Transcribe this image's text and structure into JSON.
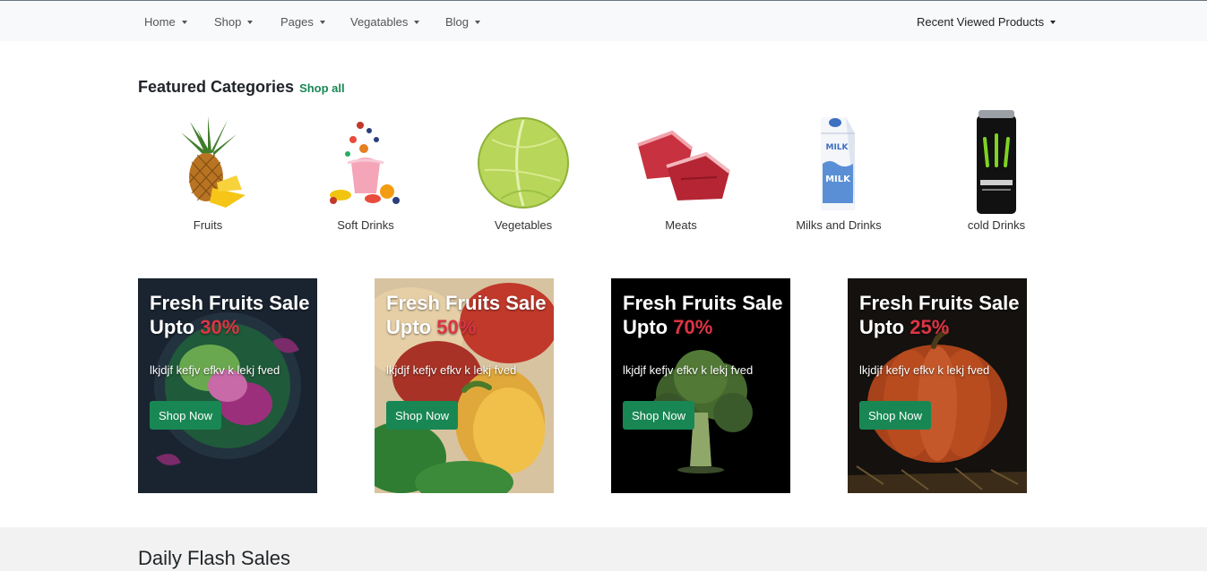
{
  "nav": {
    "items": [
      {
        "label": "Home"
      },
      {
        "label": "Shop"
      },
      {
        "label": "Pages"
      },
      {
        "label": "Vegatables"
      },
      {
        "label": "Blog"
      }
    ],
    "recent": "Recent Viewed Products"
  },
  "featured": {
    "title": "Featured Categories",
    "shop_all": "Shop all",
    "categories": [
      {
        "label": "Fruits",
        "icon": "pineapple-icon"
      },
      {
        "label": "Soft Drinks",
        "icon": "smoothie-splash-icon"
      },
      {
        "label": "Vegetables",
        "icon": "cabbage-icon"
      },
      {
        "label": "Meats",
        "icon": "meat-icon"
      },
      {
        "label": "Milks and Drinks",
        "icon": "milk-carton-icon"
      },
      {
        "label": "cold Drinks",
        "icon": "energy-drink-can-icon"
      }
    ]
  },
  "promos": [
    {
      "line1": "Fresh Fruits Sale",
      "upto": "Upto",
      "percent": "30%",
      "desc": "lkjdjf kefjv efkv k lekj fved",
      "button": "Shop Now"
    },
    {
      "line1": "Fresh Fruits Sale",
      "upto": "Upto",
      "percent": "50%",
      "desc": "lkjdjf kefjv efkv k lekj fved",
      "button": "Shop Now"
    },
    {
      "line1": "Fresh Fruits Sale",
      "upto": "Upto",
      "percent": "70%",
      "desc": "lkjdjf kefjv efkv k lekj fved",
      "button": "Shop Now"
    },
    {
      "line1": "Fresh Fruits Sale",
      "upto": "Upto",
      "percent": "25%",
      "desc": "lkjdjf kefjv efkv k lekj fved",
      "button": "Shop Now"
    }
  ],
  "flash": {
    "title": "Daily Flash Sales"
  },
  "colors": {
    "accent": "#198754",
    "discount": "#dc3545",
    "nav_bg": "#f8f9fa"
  }
}
